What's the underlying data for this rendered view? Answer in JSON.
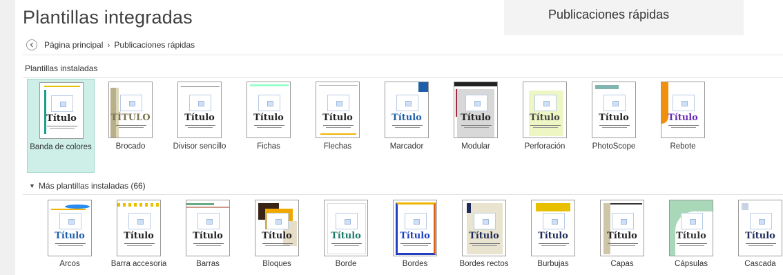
{
  "page": {
    "title": "Plantillas integradas"
  },
  "breadcrumb": {
    "home": "Página principal",
    "separator": "›",
    "current": "Publicaciones rápidas"
  },
  "panel": {
    "title": "Publicaciones rápidas"
  },
  "installed": {
    "label": "Plantillas instaladas",
    "items": [
      {
        "name": "Banda de colores",
        "title": "Título",
        "selected": true
      },
      {
        "name": "Brocado",
        "title": "TÍTULO"
      },
      {
        "name": "Divisor sencillo",
        "title": "Título"
      },
      {
        "name": "Fichas",
        "title": "Título"
      },
      {
        "name": "Flechas",
        "title": "Título"
      },
      {
        "name": "Marcador",
        "title": "Título"
      },
      {
        "name": "Modular",
        "title": "Título"
      },
      {
        "name": "Perforación",
        "title": "Título"
      },
      {
        "name": "PhotoScope",
        "title": "Título"
      },
      {
        "name": "Rebote",
        "title": "Título"
      }
    ]
  },
  "more": {
    "label": "Más plantillas instaladas (66)",
    "items": [
      {
        "name": "Arcos",
        "title": "Título"
      },
      {
        "name": "Barra accesoria",
        "title": "Título"
      },
      {
        "name": "Barras",
        "title": "Título"
      },
      {
        "name": "Bloques",
        "title": "Título"
      },
      {
        "name": "Borde",
        "title": "Título"
      },
      {
        "name": "Bordes",
        "title": "Título"
      },
      {
        "name": "Bordes rectos",
        "title": "Título"
      },
      {
        "name": "Burbujas",
        "title": "Título"
      },
      {
        "name": "Capas",
        "title": "Título"
      },
      {
        "name": "Cápsulas",
        "title": "Título"
      },
      {
        "name": "Cascada",
        "title": "Título"
      }
    ]
  },
  "colors": {
    "selection": "#cdefe8",
    "accent_teal": "#1a9e8a",
    "accent_blue": "#1f5fa8"
  }
}
